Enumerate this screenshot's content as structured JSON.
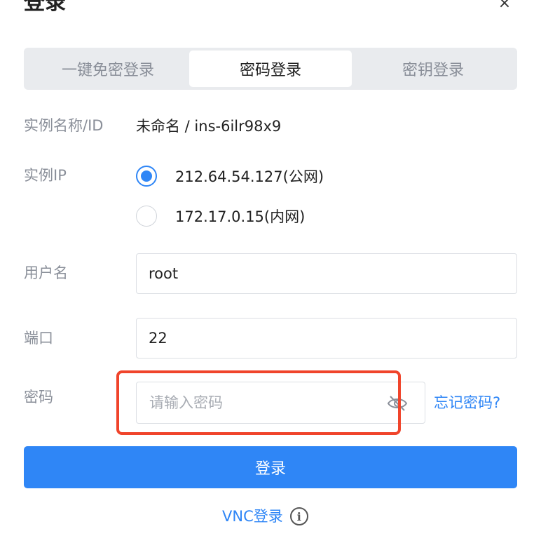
{
  "dialog": {
    "title": "登录",
    "close_symbol": "×"
  },
  "tabs": [
    {
      "label": "一键免密登录",
      "active": false
    },
    {
      "label": "密码登录",
      "active": true
    },
    {
      "label": "密钥登录",
      "active": false
    }
  ],
  "instance": {
    "name_label": "实例名称/ID",
    "name_value": "未命名 / ins-6ilr98x9",
    "ip_label": "实例IP",
    "ip_options": [
      {
        "label": "212.64.54.127(公网)",
        "checked": true
      },
      {
        "label": "172.17.0.15(内网)",
        "checked": false
      }
    ]
  },
  "form": {
    "username_label": "用户名",
    "username_value": "root",
    "port_label": "端口",
    "port_value": "22",
    "password_label": "密码",
    "password_placeholder": "请输入密码",
    "forgot_password": "忘记密码?"
  },
  "actions": {
    "login_button": "登录",
    "vnc_login": "VNC登录",
    "info_symbol": "i"
  },
  "colors": {
    "primary": "#2f86f6",
    "highlight": "#f0442b",
    "tab_bg": "#e9ebee"
  }
}
